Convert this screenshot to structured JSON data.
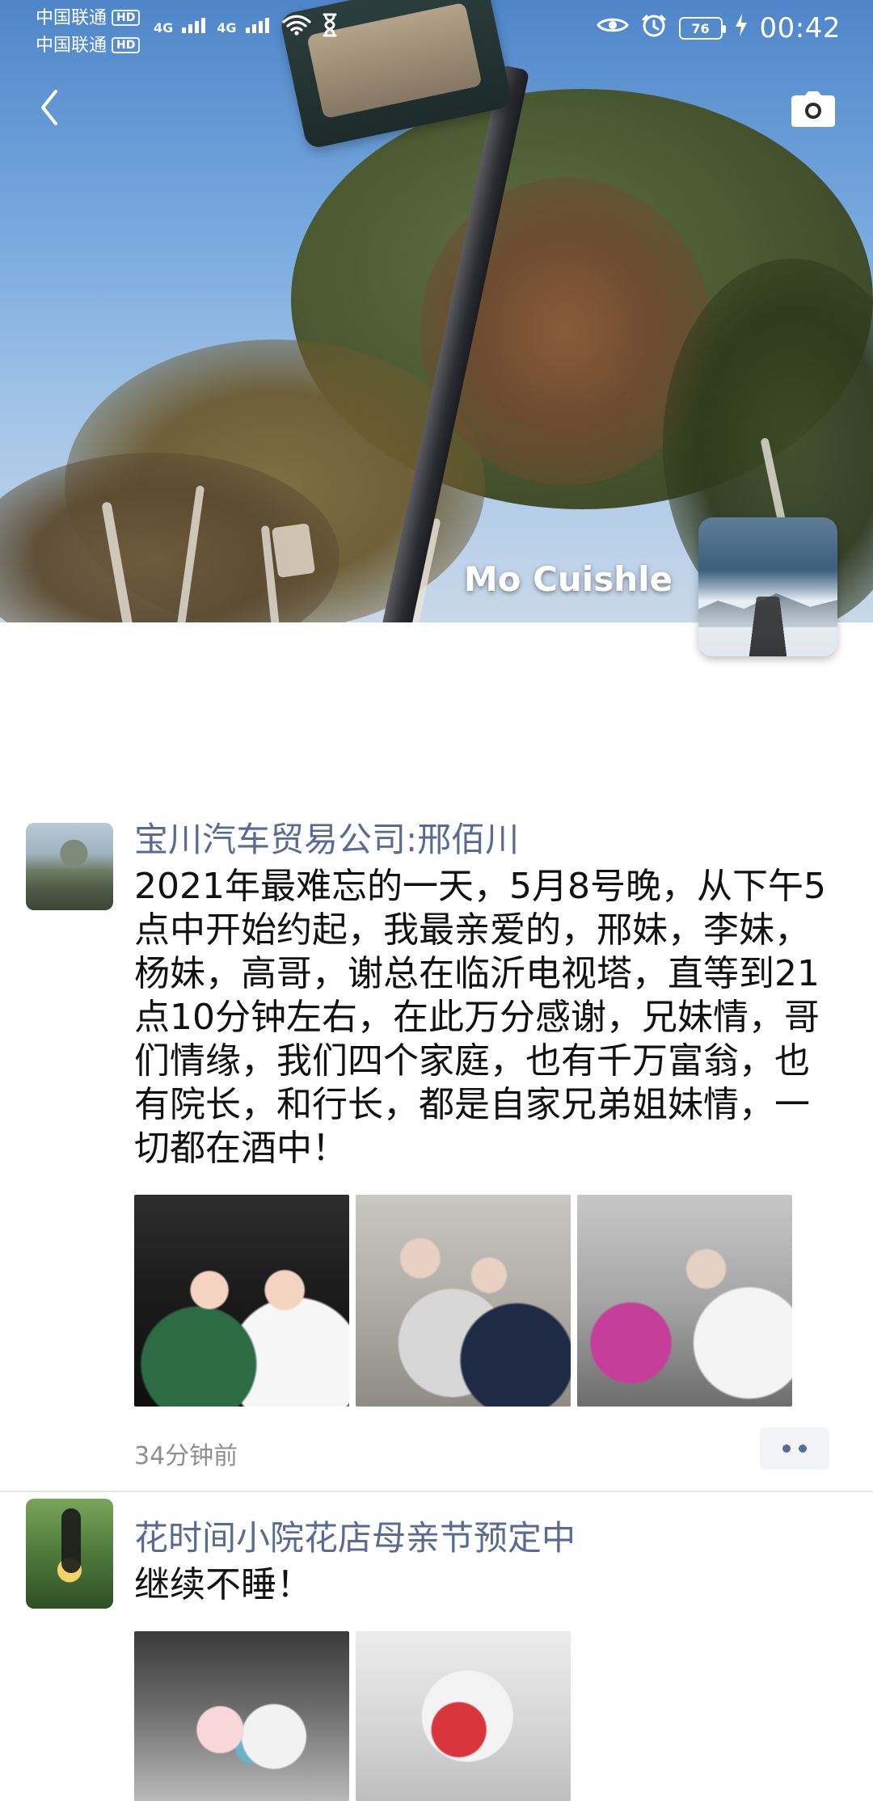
{
  "status_bar": {
    "carrier1": "中国联通",
    "carrier2": "中国联通",
    "hd_label": "HD",
    "network1": "4G",
    "network2": "4G",
    "battery": "76",
    "time": "00:42"
  },
  "header": {
    "profile_name": "Mo Cuishle"
  },
  "posts": [
    {
      "name": "宝川汽车贸易公司:邢佰川",
      "text": "2021年最难忘的一天，5月8号晚，从下午5点中开始约起，我最亲爱的，邢妹，李妹，杨妹，高哥，谢总在临沂电视塔，直等到21点10分钟左右，在此万分感谢，兄妹情，哥们情缘，我们四个家庭，也有千万富翁，也有院长，和行长，都是自家兄弟姐妹情，一切都在酒中！",
      "time": "34分钟前",
      "photos": [
        "party-photo-1",
        "party-photo-2",
        "party-photo-3"
      ]
    },
    {
      "name": "花时间小院花店母亲节预定中",
      "text": "继续不睡！",
      "photos": [
        "flower-photo-1",
        "flower-photo-2"
      ]
    }
  ],
  "icons": {
    "back": "chevron-left-icon",
    "camera": "camera-icon",
    "signal": "signal-icon",
    "wifi": "wifi-icon",
    "hourglass": "hourglass-icon",
    "eye": "eye-icon",
    "alarm": "alarm-icon",
    "charging": "charging-icon",
    "more": "more-dots-icon"
  }
}
